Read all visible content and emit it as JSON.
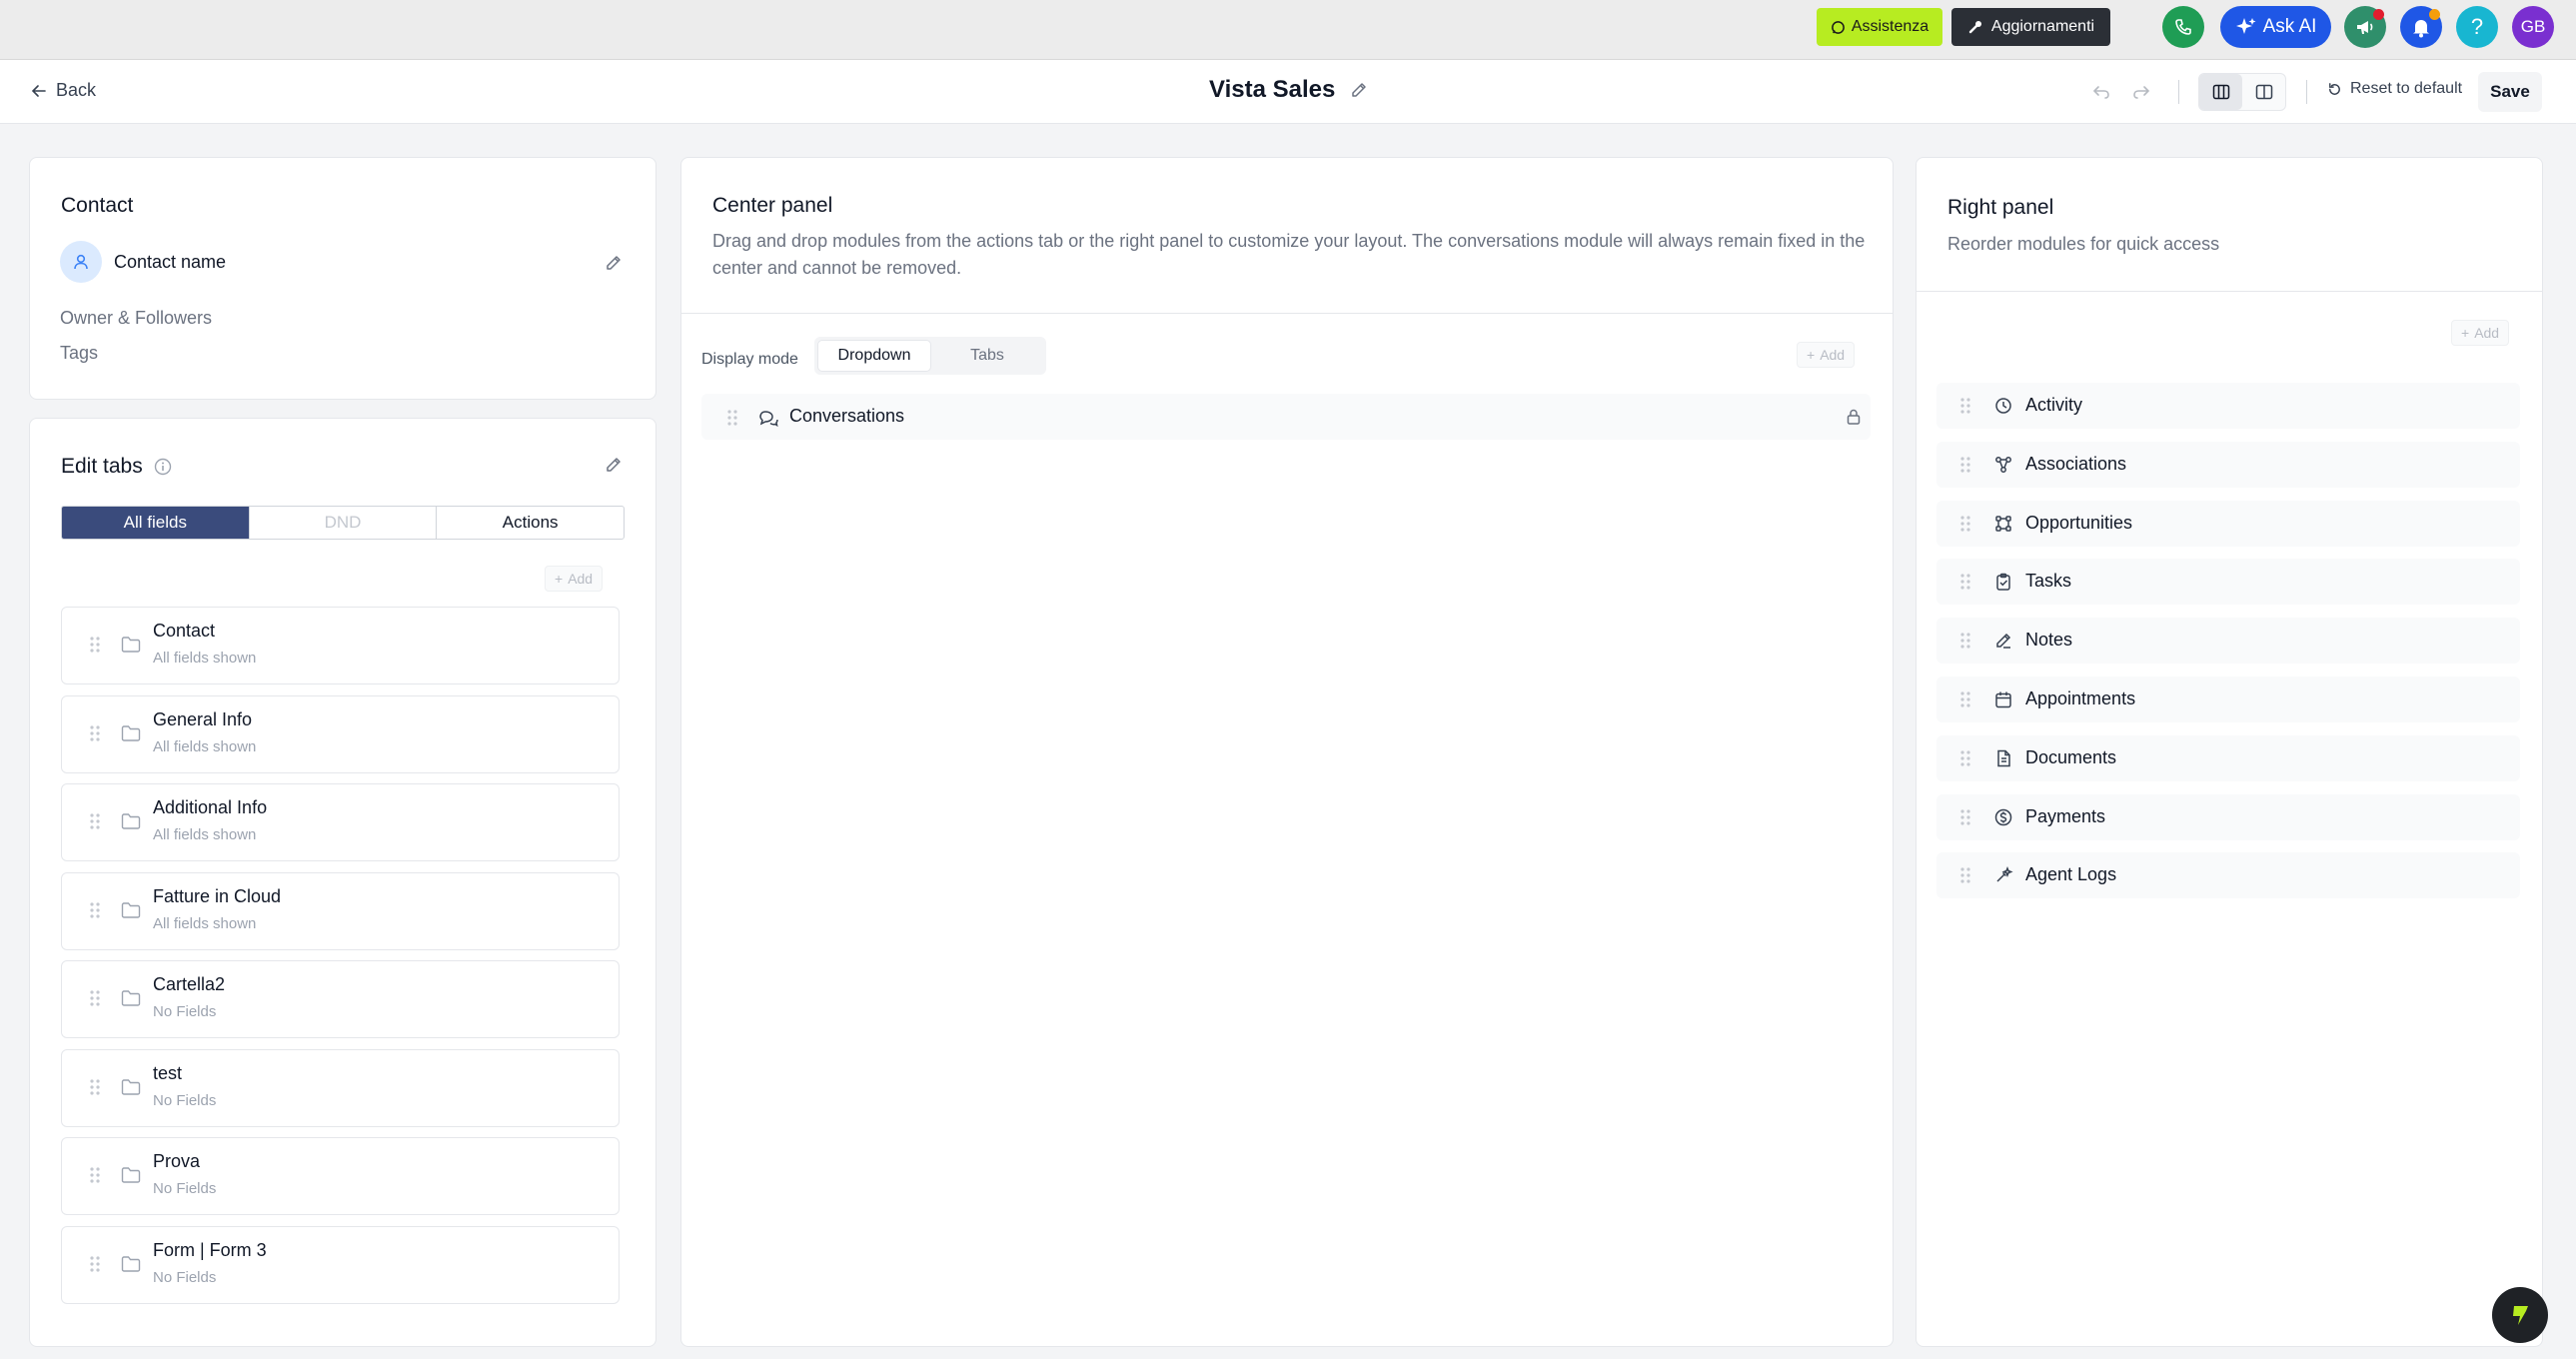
{
  "topbar": {
    "assist_label": "Assistenza",
    "updates_label": "Aggiornamenti",
    "ask_ai_label": "Ask AI",
    "help_label": "?",
    "avatar_initials": "GB",
    "colors": {
      "phone": "#1f9d55",
      "ask_ai": "#1f57e6",
      "megaphone": "#2f8f6b",
      "bell": "#1f57e6",
      "help": "#18b6d1",
      "avatar": "#7a2fd0",
      "assist_bg": "#b7ec21"
    }
  },
  "header": {
    "back_label": "Back",
    "title": "Vista Sales",
    "reset_label": "Reset to default",
    "save_label": "Save"
  },
  "contact_card": {
    "title": "Contact",
    "contact_name": "Contact name",
    "owner_followers": "Owner & Followers",
    "tags": "Tags"
  },
  "edit_tabs": {
    "title": "Edit tabs",
    "tabs": [
      {
        "label": "All fields",
        "state": "active"
      },
      {
        "label": "DND",
        "state": "disabled"
      },
      {
        "label": "Actions",
        "state": "normal"
      }
    ],
    "add_label": "Add",
    "items": [
      {
        "name": "Contact",
        "sub": "All fields shown"
      },
      {
        "name": "General Info",
        "sub": "All fields shown"
      },
      {
        "name": "Additional Info",
        "sub": "All fields shown"
      },
      {
        "name": "Fatture in Cloud",
        "sub": "All fields shown"
      },
      {
        "name": "Cartella2",
        "sub": "No Fields"
      },
      {
        "name": "test",
        "sub": "No Fields"
      },
      {
        "name": "Prova",
        "sub": "No Fields"
      },
      {
        "name": "Form | Form 3",
        "sub": "No Fields"
      }
    ]
  },
  "center_panel": {
    "title": "Center panel",
    "description": "Drag and drop modules from the actions tab or the right panel to customize your layout. The conversations module will always remain fixed in the center and cannot be removed.",
    "display_mode_label": "Display mode",
    "display_modes": [
      "Dropdown",
      "Tabs"
    ],
    "selected_mode": "Dropdown",
    "add_label": "Add",
    "modules": [
      {
        "label": "Conversations",
        "icon": "chat-icon",
        "locked": true
      }
    ]
  },
  "right_panel": {
    "title": "Right panel",
    "subtitle": "Reorder modules for quick access",
    "add_label": "Add",
    "modules": [
      {
        "label": "Activity",
        "icon": "clock-icon"
      },
      {
        "label": "Associations",
        "icon": "network-icon"
      },
      {
        "label": "Opportunities",
        "icon": "pipeline-icon"
      },
      {
        "label": "Tasks",
        "icon": "clipboard-check-icon"
      },
      {
        "label": "Notes",
        "icon": "pencil-icon"
      },
      {
        "label": "Appointments",
        "icon": "calendar-icon"
      },
      {
        "label": "Documents",
        "icon": "document-icon"
      },
      {
        "label": "Payments",
        "icon": "dollar-circle-icon"
      },
      {
        "label": "Agent Logs",
        "icon": "sparkle-pen-icon"
      }
    ]
  }
}
